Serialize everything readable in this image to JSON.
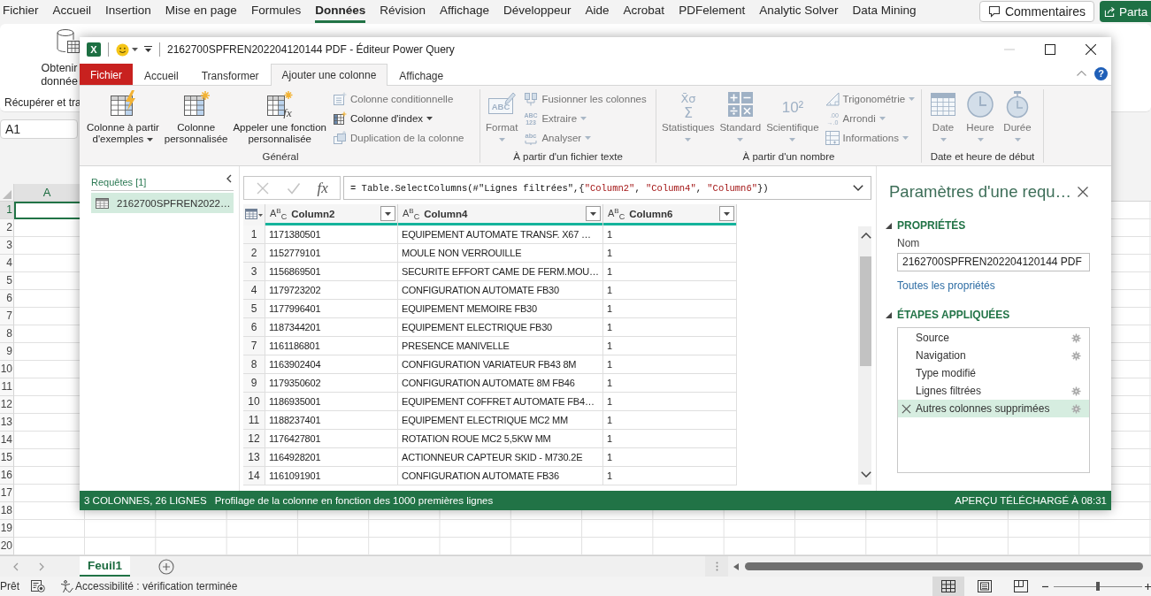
{
  "excel": {
    "menu_tabs": [
      {
        "label": "Fichier",
        "selected": false
      },
      {
        "label": "Accueil",
        "selected": false
      },
      {
        "label": "Insertion",
        "selected": false
      },
      {
        "label": "Mise en page",
        "selected": false
      },
      {
        "label": "Formules",
        "selected": false
      },
      {
        "label": "Données",
        "selected": true
      },
      {
        "label": "Révision",
        "selected": false
      },
      {
        "label": "Affichage",
        "selected": false
      },
      {
        "label": "Développeur",
        "selected": false
      },
      {
        "label": "Aide",
        "selected": false
      },
      {
        "label": "Acrobat",
        "selected": false
      },
      {
        "label": "PDFelement",
        "selected": false
      },
      {
        "label": "Analytic Solver",
        "selected": false
      },
      {
        "label": "Data Mining",
        "selected": false
      }
    ],
    "comments_button": "Commentaires",
    "share_button": "Parta",
    "ribbon": {
      "get_data_button": [
        "Obtenir",
        "donnée"
      ],
      "group_label": "Récupérer et tra"
    },
    "name_box": "A1",
    "column_headers": [
      {
        "label": "A",
        "selected": true
      }
    ],
    "rows": [
      {
        "label": "1",
        "selected": true
      },
      {
        "label": "2",
        "selected": false
      },
      {
        "label": "3",
        "selected": false
      },
      {
        "label": "4",
        "selected": false
      },
      {
        "label": "5",
        "selected": false
      },
      {
        "label": "6",
        "selected": false
      },
      {
        "label": "7",
        "selected": false
      },
      {
        "label": "8",
        "selected": false
      },
      {
        "label": "9",
        "selected": false
      },
      {
        "label": "10",
        "selected": false
      },
      {
        "label": "11",
        "selected": false
      },
      {
        "label": "12",
        "selected": false
      },
      {
        "label": "13",
        "selected": false
      },
      {
        "label": "14",
        "selected": false
      },
      {
        "label": "15",
        "selected": false
      },
      {
        "label": "16",
        "selected": false
      },
      {
        "label": "17",
        "selected": false
      },
      {
        "label": "18",
        "selected": false
      },
      {
        "label": "19",
        "selected": false
      },
      {
        "label": "20",
        "selected": false
      }
    ],
    "sheet_tabs": [
      {
        "label": "Feuil1",
        "selected": true
      }
    ],
    "status_bar": {
      "ready": "Prêt",
      "accessibility": "Accessibilité : vérification terminée",
      "views": [
        {
          "kind": "normal",
          "selected": true
        },
        {
          "kind": "page_layout",
          "selected": false
        },
        {
          "kind": "page_break",
          "selected": false
        }
      ],
      "zoom": {
        "level": 0.5
      }
    }
  },
  "power_query": {
    "app_icon": "X",
    "title": "2162700SPFREN202204120144 PDF - Éditeur Power Query",
    "window_controls": [
      {
        "kind": "minimize",
        "disabled": true
      },
      {
        "kind": "maximize",
        "disabled": false
      },
      {
        "kind": "close",
        "disabled": false
      }
    ],
    "tabs": [
      {
        "label": "Fichier",
        "kind": "file",
        "selected": false
      },
      {
        "label": "Accueil",
        "kind": "tab",
        "selected": false
      },
      {
        "label": "Transformer",
        "kind": "tab",
        "selected": false
      },
      {
        "label": "Ajouter une colonne",
        "kind": "tab",
        "selected": true
      },
      {
        "label": "Affichage",
        "kind": "tab",
        "selected": false
      }
    ],
    "help_button": "?",
    "ribbon_groups": [
      {
        "label": "Général",
        "items": [
          {
            "kind": "large",
            "lines": [
              "Colonne à partir",
              "d'exemples"
            ],
            "dropdown": true,
            "disabled": false
          },
          {
            "kind": "large",
            "lines": [
              "Colonne",
              "personnalisée"
            ],
            "dropdown": false,
            "disabled": false
          },
          {
            "kind": "large",
            "lines": [
              "Appeler une fonction",
              "personnalisée"
            ],
            "dropdown": false,
            "disabled": false,
            "icon_text": [
              "fx"
            ]
          },
          {
            "kind": "small",
            "lines": [
              "Colonne conditionnelle"
            ],
            "dropdown": false,
            "disabled": true
          },
          {
            "kind": "small",
            "lines": [
              "Colonne d'index"
            ],
            "dropdown": true,
            "disabled": false
          },
          {
            "kind": "small",
            "lines": [
              "Duplication de la colonne"
            ],
            "dropdown": false,
            "disabled": true
          }
        ]
      },
      {
        "label": "À partir d'un fichier texte",
        "items": [
          {
            "kind": "large",
            "lines": [
              "Format"
            ],
            "dropdown": true,
            "disabled": true,
            "icon_text": [
              "ABC"
            ]
          },
          {
            "kind": "small",
            "lines": [
              "Fusionner les colonnes"
            ],
            "dropdown": false,
            "disabled": true
          },
          {
            "kind": "small",
            "lines": [
              "Extraire"
            ],
            "dropdown": true,
            "disabled": true,
            "icon_text": [
              "ABC",
              "123"
            ]
          },
          {
            "kind": "small",
            "lines": [
              "Analyser"
            ],
            "dropdown": true,
            "disabled": true,
            "icon_text": [
              "abc"
            ]
          }
        ]
      },
      {
        "label": "À partir d'un nombre",
        "items": [
          {
            "kind": "large",
            "lines": [
              "Statistiques"
            ],
            "dropdown": true,
            "disabled": true,
            "icon_text": [
              "X̄σ",
              "Σ"
            ]
          },
          {
            "kind": "large",
            "lines": [
              "Standard"
            ],
            "dropdown": true,
            "disabled": true
          },
          {
            "kind": "large",
            "lines": [
              "Scientifique"
            ],
            "dropdown": true,
            "disabled": true,
            "icon_text": [
              "10²"
            ]
          },
          {
            "kind": "small",
            "lines": [
              "Trigonométrie"
            ],
            "dropdown": true,
            "disabled": true
          },
          {
            "kind": "small",
            "lines": [
              "Arrondi"
            ],
            "dropdown": true,
            "disabled": true,
            "icon_text": [
              ".00",
              "→.0"
            ]
          },
          {
            "kind": "small",
            "lines": [
              "Informations"
            ],
            "dropdown": true,
            "disabled": true
          }
        ]
      },
      {
        "label": "Date et heure de début",
        "items": [
          {
            "kind": "large",
            "lines": [
              "Date"
            ],
            "dropdown": true,
            "disabled": true
          },
          {
            "kind": "large",
            "lines": [
              "Heure"
            ],
            "dropdown": true,
            "disabled": true
          },
          {
            "kind": "large",
            "lines": [
              "Durée"
            ],
            "dropdown": true,
            "disabled": true
          }
        ]
      }
    ],
    "queries_pane": {
      "title": "Requêtes [1]",
      "items": [
        {
          "label": "2162700SPFREN2022…",
          "selected": true
        }
      ]
    },
    "formula_bar": {
      "buttons": [
        {
          "kind": "cancel",
          "disabled": true
        },
        {
          "kind": "commit",
          "disabled": true
        }
      ],
      "fx_button": "fx",
      "tokens": [
        {
          "text": "= Table.SelectColumns(#\"Lignes filtrées\",{",
          "kind": "plain"
        },
        {
          "text": "\"Column2\"",
          "kind": "string"
        },
        {
          "text": ", ",
          "kind": "plain"
        },
        {
          "text": "\"Column4\"",
          "kind": "string"
        },
        {
          "text": ", ",
          "kind": "plain"
        },
        {
          "text": "\"Column6\"",
          "kind": "string"
        },
        {
          "text": "})",
          "kind": "plain"
        }
      ]
    },
    "table": {
      "columns": [
        {
          "name": "Column2",
          "type_label": "A$^{B}$$_{C}$"
        },
        {
          "name": "Column4",
          "type_label": "A$^{B}$$_{C}$"
        },
        {
          "name": "Column6",
          "type_label": "A$^{B}$$_{C}$"
        }
      ],
      "rows": [
        {
          "index": "1",
          "cells": [
            "1171380501",
            "EQUIPEMENT AUTOMATE TRANSF. X67 …",
            "1"
          ]
        },
        {
          "index": "2",
          "cells": [
            "1152779101",
            "MOULE NON VERROUILLE",
            "1"
          ]
        },
        {
          "index": "3",
          "cells": [
            "1156869501",
            "SECURITE EFFORT CAME DE FERM.MOU…",
            "1"
          ]
        },
        {
          "index": "4",
          "cells": [
            "1179723202",
            "CONFIGURATION AUTOMATE FB30",
            "1"
          ]
        },
        {
          "index": "5",
          "cells": [
            "1177996401",
            "EQUIPEMENT MEMOIRE FB30",
            "1"
          ]
        },
        {
          "index": "6",
          "cells": [
            "1187344201",
            "EQUIPEMENT ELECTRIQUE FB30",
            "1"
          ]
        },
        {
          "index": "7",
          "cells": [
            "1161186801",
            "PRESENCE MANIVELLE",
            "1"
          ]
        },
        {
          "index": "8",
          "cells": [
            "1163902404",
            "CONFIGURATION VARIATEUR FB43 8M",
            "1"
          ]
        },
        {
          "index": "9",
          "cells": [
            "1179350602",
            "CONFIGURATION AUTOMATE 8M FB46",
            "1"
          ]
        },
        {
          "index": "10",
          "cells": [
            "1186935001",
            "EQUIPEMENT COFFRET AUTOMATE FB4…",
            "1"
          ]
        },
        {
          "index": "11",
          "cells": [
            "1188237401",
            "EQUIPEMENT ELECTRIQUE MC2 MM",
            "1"
          ]
        },
        {
          "index": "12",
          "cells": [
            "1176427801",
            "ROTATION ROUE MC2 5,5KW MM",
            "1"
          ]
        },
        {
          "index": "13",
          "cells": [
            "1164928201",
            "ACTIONNEUR CAPTEUR SKID - M730.2E",
            "1"
          ]
        },
        {
          "index": "14",
          "cells": [
            "1161091901",
            "CONFIGURATION AUTOMATE FB36",
            "1"
          ]
        }
      ]
    },
    "query_settings": {
      "title": "Paramètres d'une requ…",
      "properties": {
        "heading": "PROPRIÉTÉS",
        "expanded": true,
        "name_label": "Nom",
        "name_value": "2162700SPFREN202204120144 PDF",
        "all_properties_link": "Toutes les propriétés"
      },
      "applied_steps": {
        "heading": "ÉTAPES APPLIQUÉES",
        "expanded": true,
        "steps": [
          {
            "label": "Source",
            "has_settings": true,
            "selected": false
          },
          {
            "label": "Navigation",
            "has_settings": true,
            "selected": false
          },
          {
            "label": "Type modifié",
            "has_settings": false,
            "selected": false
          },
          {
            "label": "Lignes filtrées",
            "has_settings": true,
            "selected": false
          },
          {
            "label": "Autres colonnes supprimées",
            "has_settings": true,
            "selected": true
          }
        ]
      }
    },
    "status_bar": {
      "summary": "3 COLONNES, 26 LIGNES",
      "profiling": "Profilage de la colonne en fonction des 1000 premières lignes",
      "preview": "APERÇU TÉLÉCHARGÉ À 08:31"
    }
  }
}
